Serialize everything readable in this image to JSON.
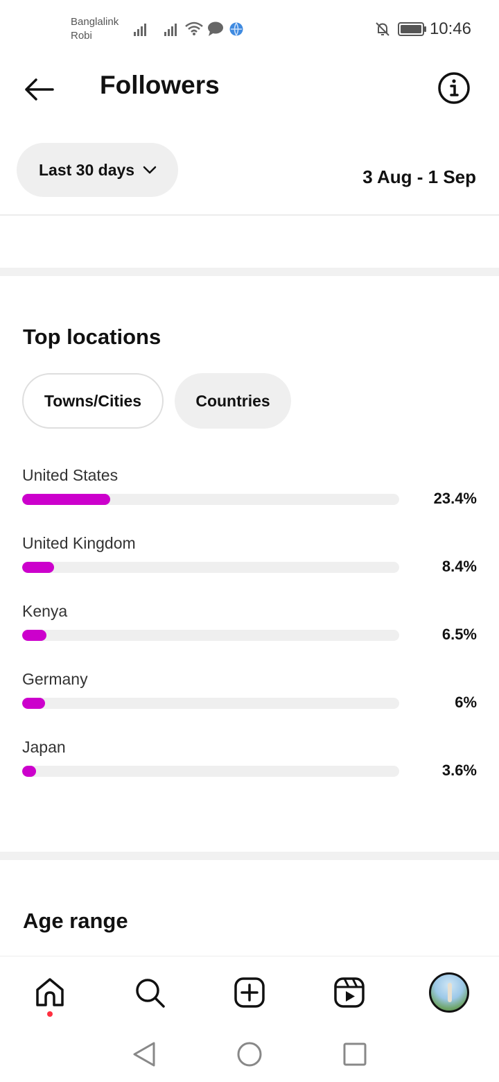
{
  "status_bar": {
    "carrier_1": "Banglalink",
    "carrier_2": "Robi",
    "time": "10:46",
    "icons": [
      "signal-icon",
      "signal-icon",
      "wifi-icon",
      "message-icon",
      "vpn-icon",
      "mute-icon",
      "battery-icon"
    ]
  },
  "header": {
    "title": "Followers",
    "back_icon": "arrow-left-icon",
    "info_icon": "info-icon"
  },
  "filters": {
    "period_label": "Last 30 days",
    "date_range": "3 Aug - 1 Sep"
  },
  "top_locations": {
    "title": "Top locations",
    "tabs": [
      {
        "label": "Towns/Cities",
        "selected": false
      },
      {
        "label": "Countries",
        "selected": true
      }
    ],
    "items": [
      {
        "name": "United States",
        "percent_label": "23.4%",
        "value": 23.4
      },
      {
        "name": "United Kingdom",
        "percent_label": "8.4%",
        "value": 8.4
      },
      {
        "name": "Kenya",
        "percent_label": "6.5%",
        "value": 6.5
      },
      {
        "name": "Germany",
        "percent_label": "6%",
        "value": 6
      },
      {
        "name": "Japan",
        "percent_label": "3.6%",
        "value": 3.6
      }
    ],
    "bar_color": "#cc00cc",
    "track_color": "#efefef"
  },
  "age_range": {
    "title": "Age range"
  },
  "bottom_nav": {
    "items": [
      "home-icon",
      "search-icon",
      "create-icon",
      "reels-icon",
      "profile-avatar"
    ],
    "notification_dot_color": "#ff3040"
  },
  "system_nav": {
    "items": [
      "back-triangle-icon",
      "home-circle-icon",
      "recents-square-icon"
    ]
  }
}
